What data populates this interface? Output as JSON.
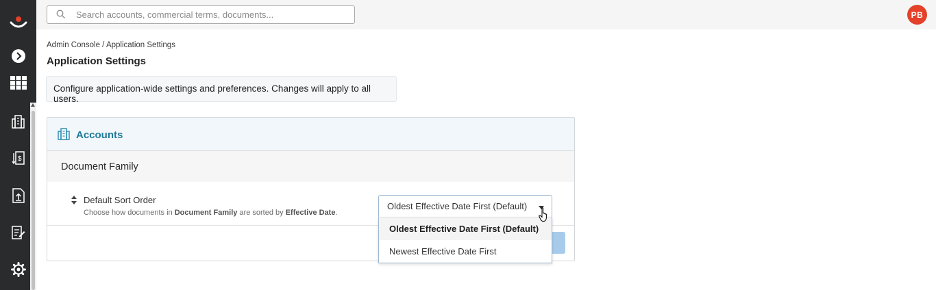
{
  "topbar": {
    "search_placeholder": "Search accounts, commercial terms, documents...",
    "avatar_initials": "PB",
    "avatar_color": "#e4402a"
  },
  "sidebar": {
    "items": [
      {
        "icon": "logo-icon"
      },
      {
        "icon": "expand-chevron-icon"
      },
      {
        "icon": "apps-grid-icon"
      },
      {
        "icon": "accounts-building-icon"
      },
      {
        "icon": "commercial-terms-icon"
      },
      {
        "icon": "document-upload-icon"
      },
      {
        "icon": "document-edit-icon"
      },
      {
        "icon": "settings-gear-icon"
      }
    ]
  },
  "breadcrumb": {
    "root": "Admin Console",
    "separator": " / ",
    "current": "Application Settings"
  },
  "page": {
    "title": "Application Settings",
    "info": "Configure application-wide settings and preferences. Changes will apply to all users."
  },
  "card": {
    "title": "Accounts",
    "title_color": "#1e7a98",
    "section_title": "Document Family",
    "setting": {
      "label": "Default Sort Order",
      "desc_prefix": "Choose how documents in ",
      "desc_bold1": "Document Family",
      "desc_mid": " are sorted by ",
      "desc_bold2": "Effective Date",
      "desc_suffix": ".",
      "selected_value": "Oldest Effective Date First (Default)",
      "options": [
        "Oldest Effective Date First (Default)",
        "Newest Effective Date First"
      ]
    }
  }
}
